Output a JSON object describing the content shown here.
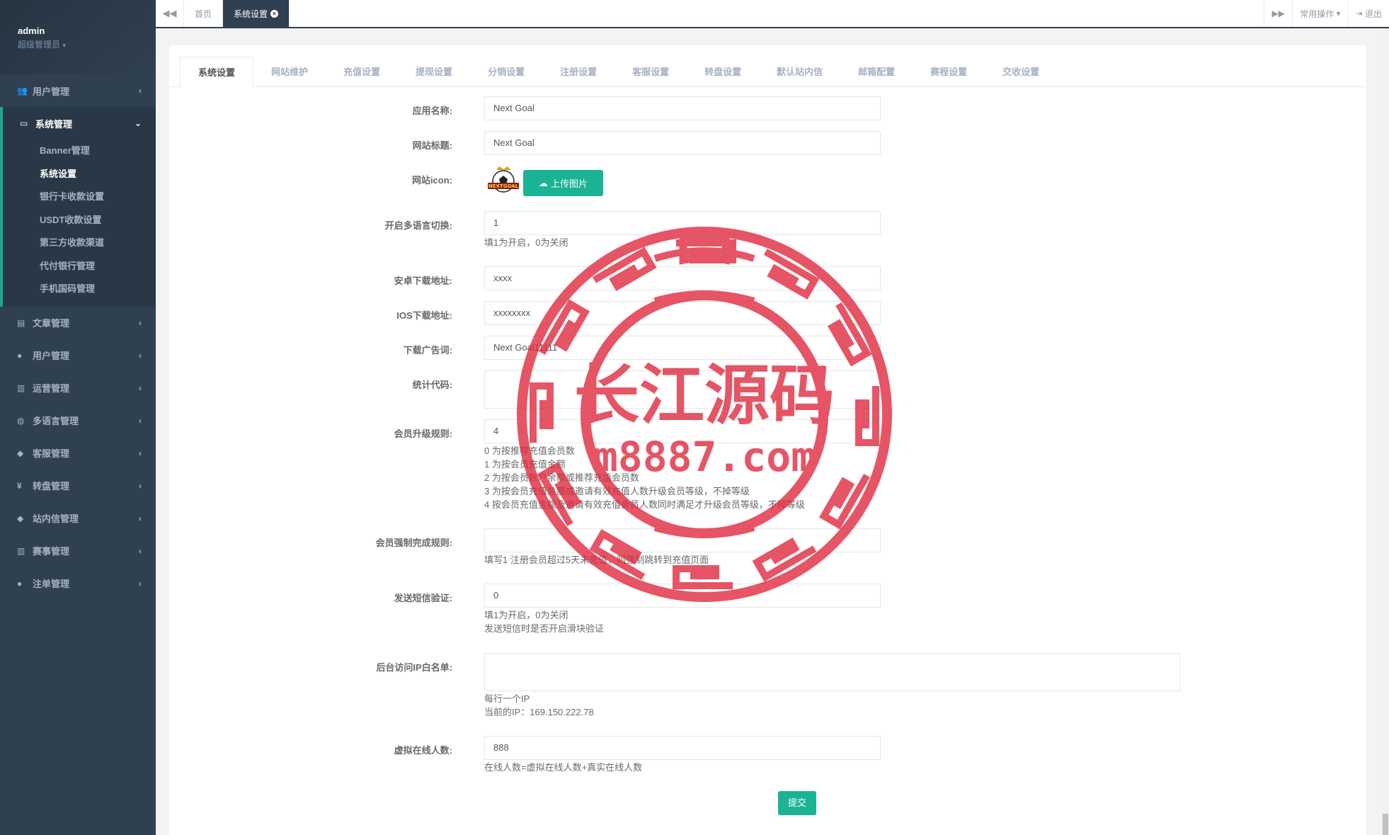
{
  "sidebar": {
    "username": "admin",
    "role": "超级管理员",
    "items": [
      {
        "label": "用户管理",
        "icon": "users-icon"
      },
      {
        "label": "文章管理",
        "icon": "book-icon"
      },
      {
        "label": "用户管理",
        "icon": "user-icon"
      },
      {
        "label": "运营管理",
        "icon": "bar-chart-icon"
      },
      {
        "label": "多语言管理",
        "icon": "globe-icon"
      },
      {
        "label": "客服管理",
        "icon": "comment-icon"
      },
      {
        "label": "转盘管理",
        "icon": "yen-icon"
      },
      {
        "label": "站内信管理",
        "icon": "comment-icon"
      },
      {
        "label": "赛事管理",
        "icon": "bar-chart-icon"
      },
      {
        "label": "注单管理",
        "icon": "user-icon"
      }
    ],
    "active_group": {
      "label": "系统管理",
      "icon": "desktop-icon",
      "children": [
        "Banner管理",
        "系统设置",
        "银行卡收款设置",
        "USDT收款设置",
        "第三方收款渠道",
        "代付银行管理",
        "手机国码管理"
      ]
    }
  },
  "topbar": {
    "tabs": [
      "首页",
      "系统设置"
    ],
    "common_ops": "常用操作",
    "logout": "退出"
  },
  "panel_tabs": [
    "系统设置",
    "网站维护",
    "充值设置",
    "提现设置",
    "分销设置",
    "注册设置",
    "客服设置",
    "转盘设置",
    "默认站内信",
    "邮箱配置",
    "赛程设置",
    "交收设置"
  ],
  "form": {
    "app_name": {
      "label": "应用名称:",
      "value": "Next Goal"
    },
    "site_title": {
      "label": "网站标题:",
      "value": "Next Goal"
    },
    "site_icon": {
      "label": "网站icon:",
      "upload": "上传图片",
      "logo_text": "NEXTGOAL"
    },
    "multilang": {
      "label": "开启多语言切换:",
      "value": "1",
      "help": "填1为开启，0为关闭"
    },
    "android_url": {
      "label": "安卓下载地址:",
      "value": "xxxx"
    },
    "ios_url": {
      "label": "IOS下载地址:",
      "value": "xxxxxxxx"
    },
    "download_ad": {
      "label": "下载广告词:",
      "value": "Next Goal11111"
    },
    "stats_code": {
      "label": "统计代码:",
      "value": ""
    },
    "upgrade_rule": {
      "label": "会员升级规则:",
      "value": "4",
      "help": [
        "0 为按推荐充值会员数",
        "1 为按会员充值金额",
        "2 为按会员账户余额或推荐充值会员数",
        "3 为按会员充值总额或邀请有效充值人数升级会员等级，不掉等级",
        "4 按会员充值金额及邀请有效充值会员人数同时满足才升级会员等级，不掉等级"
      ]
    },
    "force_rule": {
      "label": "会员强制完成规则:",
      "value": "",
      "help": "填写1 注册会员超过5天未充值，则强制跳转到充值页面"
    },
    "sms_verify": {
      "label": "发送短信验证:",
      "value": "0",
      "help": [
        "填1为开启，0为关闭",
        "发送短信时是否开启滑块验证"
      ]
    },
    "ip_whitelist": {
      "label": "后台访问IP白名单:",
      "value": "",
      "help": [
        "每行一个IP",
        "当前的IP：169.150.222.78"
      ]
    },
    "virtual_online": {
      "label": "虚拟在线人数:",
      "value": "888",
      "help": "在线人数=虚拟在线人数+真实在线人数"
    },
    "submit": "提交"
  },
  "watermark": {
    "title": "长江源码",
    "url": "m8887.com"
  },
  "colors": {
    "sidebar_bg": "#2f4050",
    "accent": "#1ab394",
    "watermark": "#e0263a"
  }
}
